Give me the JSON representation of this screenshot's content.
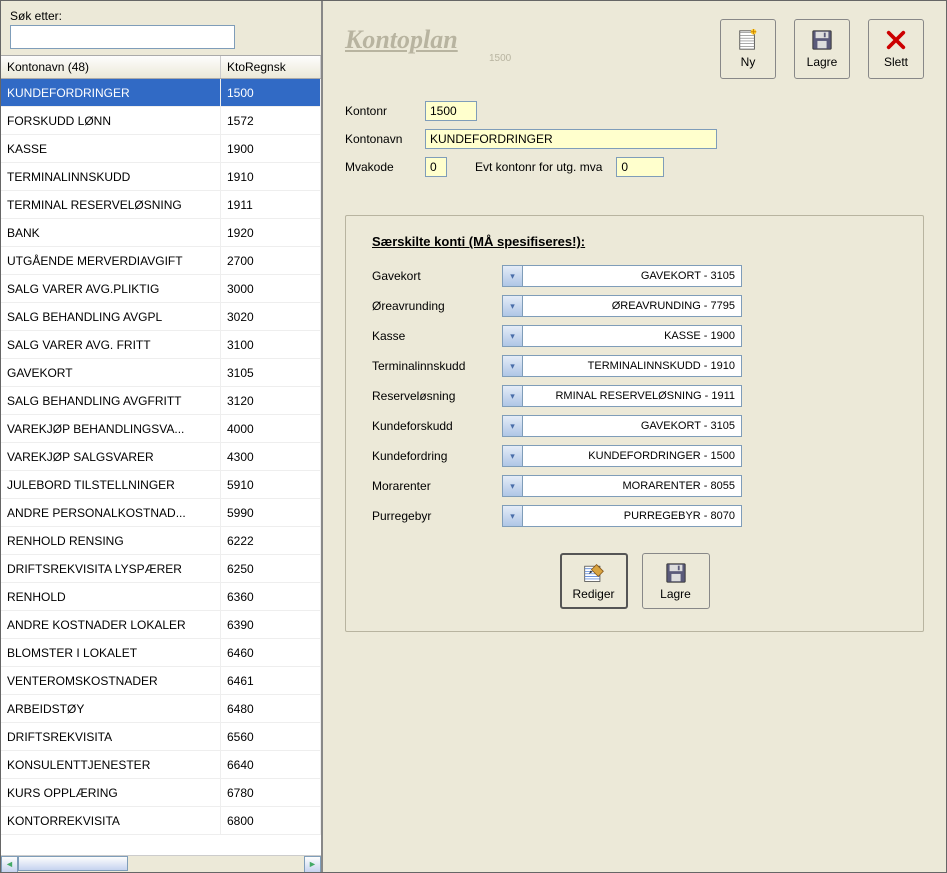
{
  "search": {
    "label": "Søk etter:",
    "value": ""
  },
  "table": {
    "header_name": "Kontonavn (48)",
    "header_code": "KtoRegnsk",
    "rows": [
      {
        "name": "KUNDEFORDRINGER",
        "code": "1500",
        "selected": true
      },
      {
        "name": "FORSKUDD LØNN",
        "code": "1572"
      },
      {
        "name": "KASSE",
        "code": "1900"
      },
      {
        "name": "TERMINALINNSKUDD",
        "code": "1910"
      },
      {
        "name": "TERMINAL RESERVELØSNING",
        "code": "1911"
      },
      {
        "name": "BANK",
        "code": "1920"
      },
      {
        "name": "UTGÅENDE MERVERDIAVGIFT",
        "code": "2700"
      },
      {
        "name": "SALG VARER AVG.PLIKTIG",
        "code": "3000"
      },
      {
        "name": "SALG BEHANDLING AVGPL",
        "code": "3020"
      },
      {
        "name": "SALG VARER AVG. FRITT",
        "code": "3100"
      },
      {
        "name": "GAVEKORT",
        "code": "3105"
      },
      {
        "name": "SALG BEHANDLING AVGFRITT",
        "code": "3120"
      },
      {
        "name": "VAREKJØP BEHANDLINGSVA...",
        "code": "4000"
      },
      {
        "name": "VAREKJØP SALGSVARER",
        "code": "4300"
      },
      {
        "name": "JULEBORD TILSTELLNINGER",
        "code": "5910"
      },
      {
        "name": "ANDRE PERSONALKOSTNAD...",
        "code": "5990"
      },
      {
        "name": "RENHOLD RENSING",
        "code": "6222"
      },
      {
        "name": "DRIFTSREKVISITA LYSPÆRER",
        "code": "6250"
      },
      {
        "name": "RENHOLD",
        "code": "6360"
      },
      {
        "name": "ANDRE KOSTNADER LOKALER",
        "code": "6390"
      },
      {
        "name": "BLOMSTER I LOKALET",
        "code": "6460"
      },
      {
        "name": "VENTEROMSKOSTNADER",
        "code": "6461"
      },
      {
        "name": "ARBEIDSTØY",
        "code": "6480"
      },
      {
        "name": "DRIFTSREKVISITA",
        "code": "6560"
      },
      {
        "name": "KONSULENTTJENESTER",
        "code": "6640"
      },
      {
        "name": "KURS OPPLÆRING",
        "code": "6780"
      },
      {
        "name": "KONTORREKVISITA",
        "code": "6800"
      }
    ]
  },
  "title": {
    "main": "Kontoplan",
    "sub": "1500"
  },
  "actions": {
    "new": "Ny",
    "save": "Lagre",
    "delete": "Slett"
  },
  "form": {
    "kontonr_label": "Kontonr",
    "kontonr_value": "1500",
    "kontonavn_label": "Kontonavn",
    "kontonavn_value": "KUNDEFORDRINGER",
    "mvakode_label": "Mvakode",
    "mvakode_value": "0",
    "evt_label": "Evt kontonr for utg. mva",
    "evt_value": "0"
  },
  "group": {
    "title": "Særskilte konti (MÅ spesifiseres!):",
    "rows": [
      {
        "label": "Gavekort",
        "value": "GAVEKORT - 3105"
      },
      {
        "label": "Øreavrunding",
        "value": "ØREAVRUNDING - 7795"
      },
      {
        "label": "Kasse",
        "value": "KASSE - 1900"
      },
      {
        "label": "Terminalinnskudd",
        "value": "TERMINALINNSKUDD - 1910"
      },
      {
        "label": "Reserveløsning",
        "value": "RMINAL RESERVELØSNING - 1911"
      },
      {
        "label": "Kundeforskudd",
        "value": "GAVEKORT - 3105"
      },
      {
        "label": "Kundefordring",
        "value": "KUNDEFORDRINGER - 1500"
      },
      {
        "label": "Morarenter",
        "value": "MORARENTER - 8055"
      },
      {
        "label": "Purregebyr",
        "value": "PURREGEBYR - 8070"
      }
    ],
    "edit": "Rediger",
    "save": "Lagre"
  }
}
